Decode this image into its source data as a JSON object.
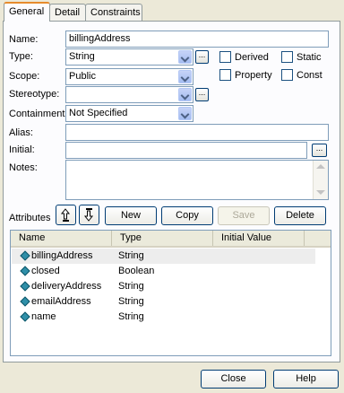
{
  "tabs": [
    {
      "label": "General"
    },
    {
      "label": "Detail"
    },
    {
      "label": "Constraints"
    }
  ],
  "form": {
    "name_label": "Name:",
    "name_value": "billingAddress",
    "type_label": "Type:",
    "type_value": "String",
    "scope_label": "Scope:",
    "scope_value": "Public",
    "stereotype_label": "Stereotype:",
    "stereotype_value": "",
    "containment_label": "Containment:",
    "containment_value": "Not Specified",
    "alias_label": "Alias:",
    "alias_value": "",
    "initial_label": "Initial:",
    "initial_value": "",
    "notes_label": "Notes:",
    "notes_value": "",
    "ellipsis": "...",
    "checkboxes": {
      "derived": "Derived",
      "static": "Static",
      "property": "Property",
      "const": "Const"
    }
  },
  "attributes": {
    "label": "Attributes",
    "buttons": {
      "new": "New",
      "copy": "Copy",
      "save": "Save",
      "delete": "Delete"
    },
    "columns": [
      "Name",
      "Type",
      "Initial Value"
    ],
    "rows": [
      {
        "name": "billingAddress",
        "type": "String"
      },
      {
        "name": "closed",
        "type": "Boolean"
      },
      {
        "name": "deliveryAddress",
        "type": "String"
      },
      {
        "name": "emailAddress",
        "type": "String"
      },
      {
        "name": "name",
        "type": "String"
      }
    ]
  },
  "footer": {
    "close": "Close",
    "help": "Help"
  },
  "colors": {
    "tab_accent": "#e68b2c",
    "input_border": "#7f9db9",
    "dialog_bg": "#ece9d8"
  },
  "icons": [
    "combo-arrow-icon",
    "attribute-gem-icon",
    "move-up-icon",
    "move-down-icon"
  ]
}
